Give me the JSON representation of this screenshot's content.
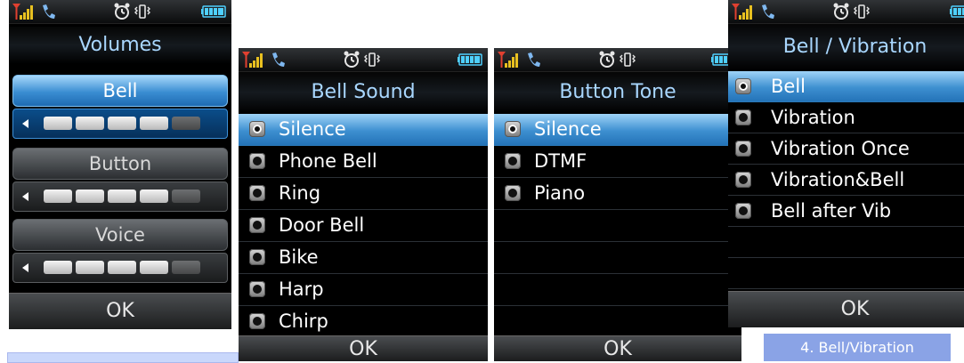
{
  "screens": {
    "volumes": {
      "title": "Volumes",
      "items": [
        {
          "label": "Bell",
          "level": 4,
          "max": 5
        },
        {
          "label": "Button",
          "level": 4,
          "max": 5
        },
        {
          "label": "Voice",
          "level": 4,
          "max": 5
        }
      ],
      "softkey": "OK"
    },
    "bell_sound": {
      "title": "Bell Sound",
      "items": [
        "Silence",
        "Phone Bell",
        "Ring",
        "Door Bell",
        "Bike",
        "Harp",
        "Chirp"
      ],
      "selected": "Silence",
      "softkey": "OK"
    },
    "button_tone": {
      "title": "Button Tone",
      "items": [
        "Silence",
        "DTMF",
        "Piano"
      ],
      "selected": "Silence",
      "softkey": "OK"
    },
    "bell_vibration": {
      "title": "Bell / Vibration",
      "items": [
        "Bell",
        "Vibration",
        "Vibration Once",
        "Vibration&Bell",
        "Bell after Vib"
      ],
      "selected": "Bell",
      "softkey": "OK",
      "caption": "4. Bell/Vibration"
    }
  },
  "colors": {
    "title_text": "#a9d7ff",
    "selection": "#3d8fd0",
    "caption_bg": "#8aa3e6"
  }
}
